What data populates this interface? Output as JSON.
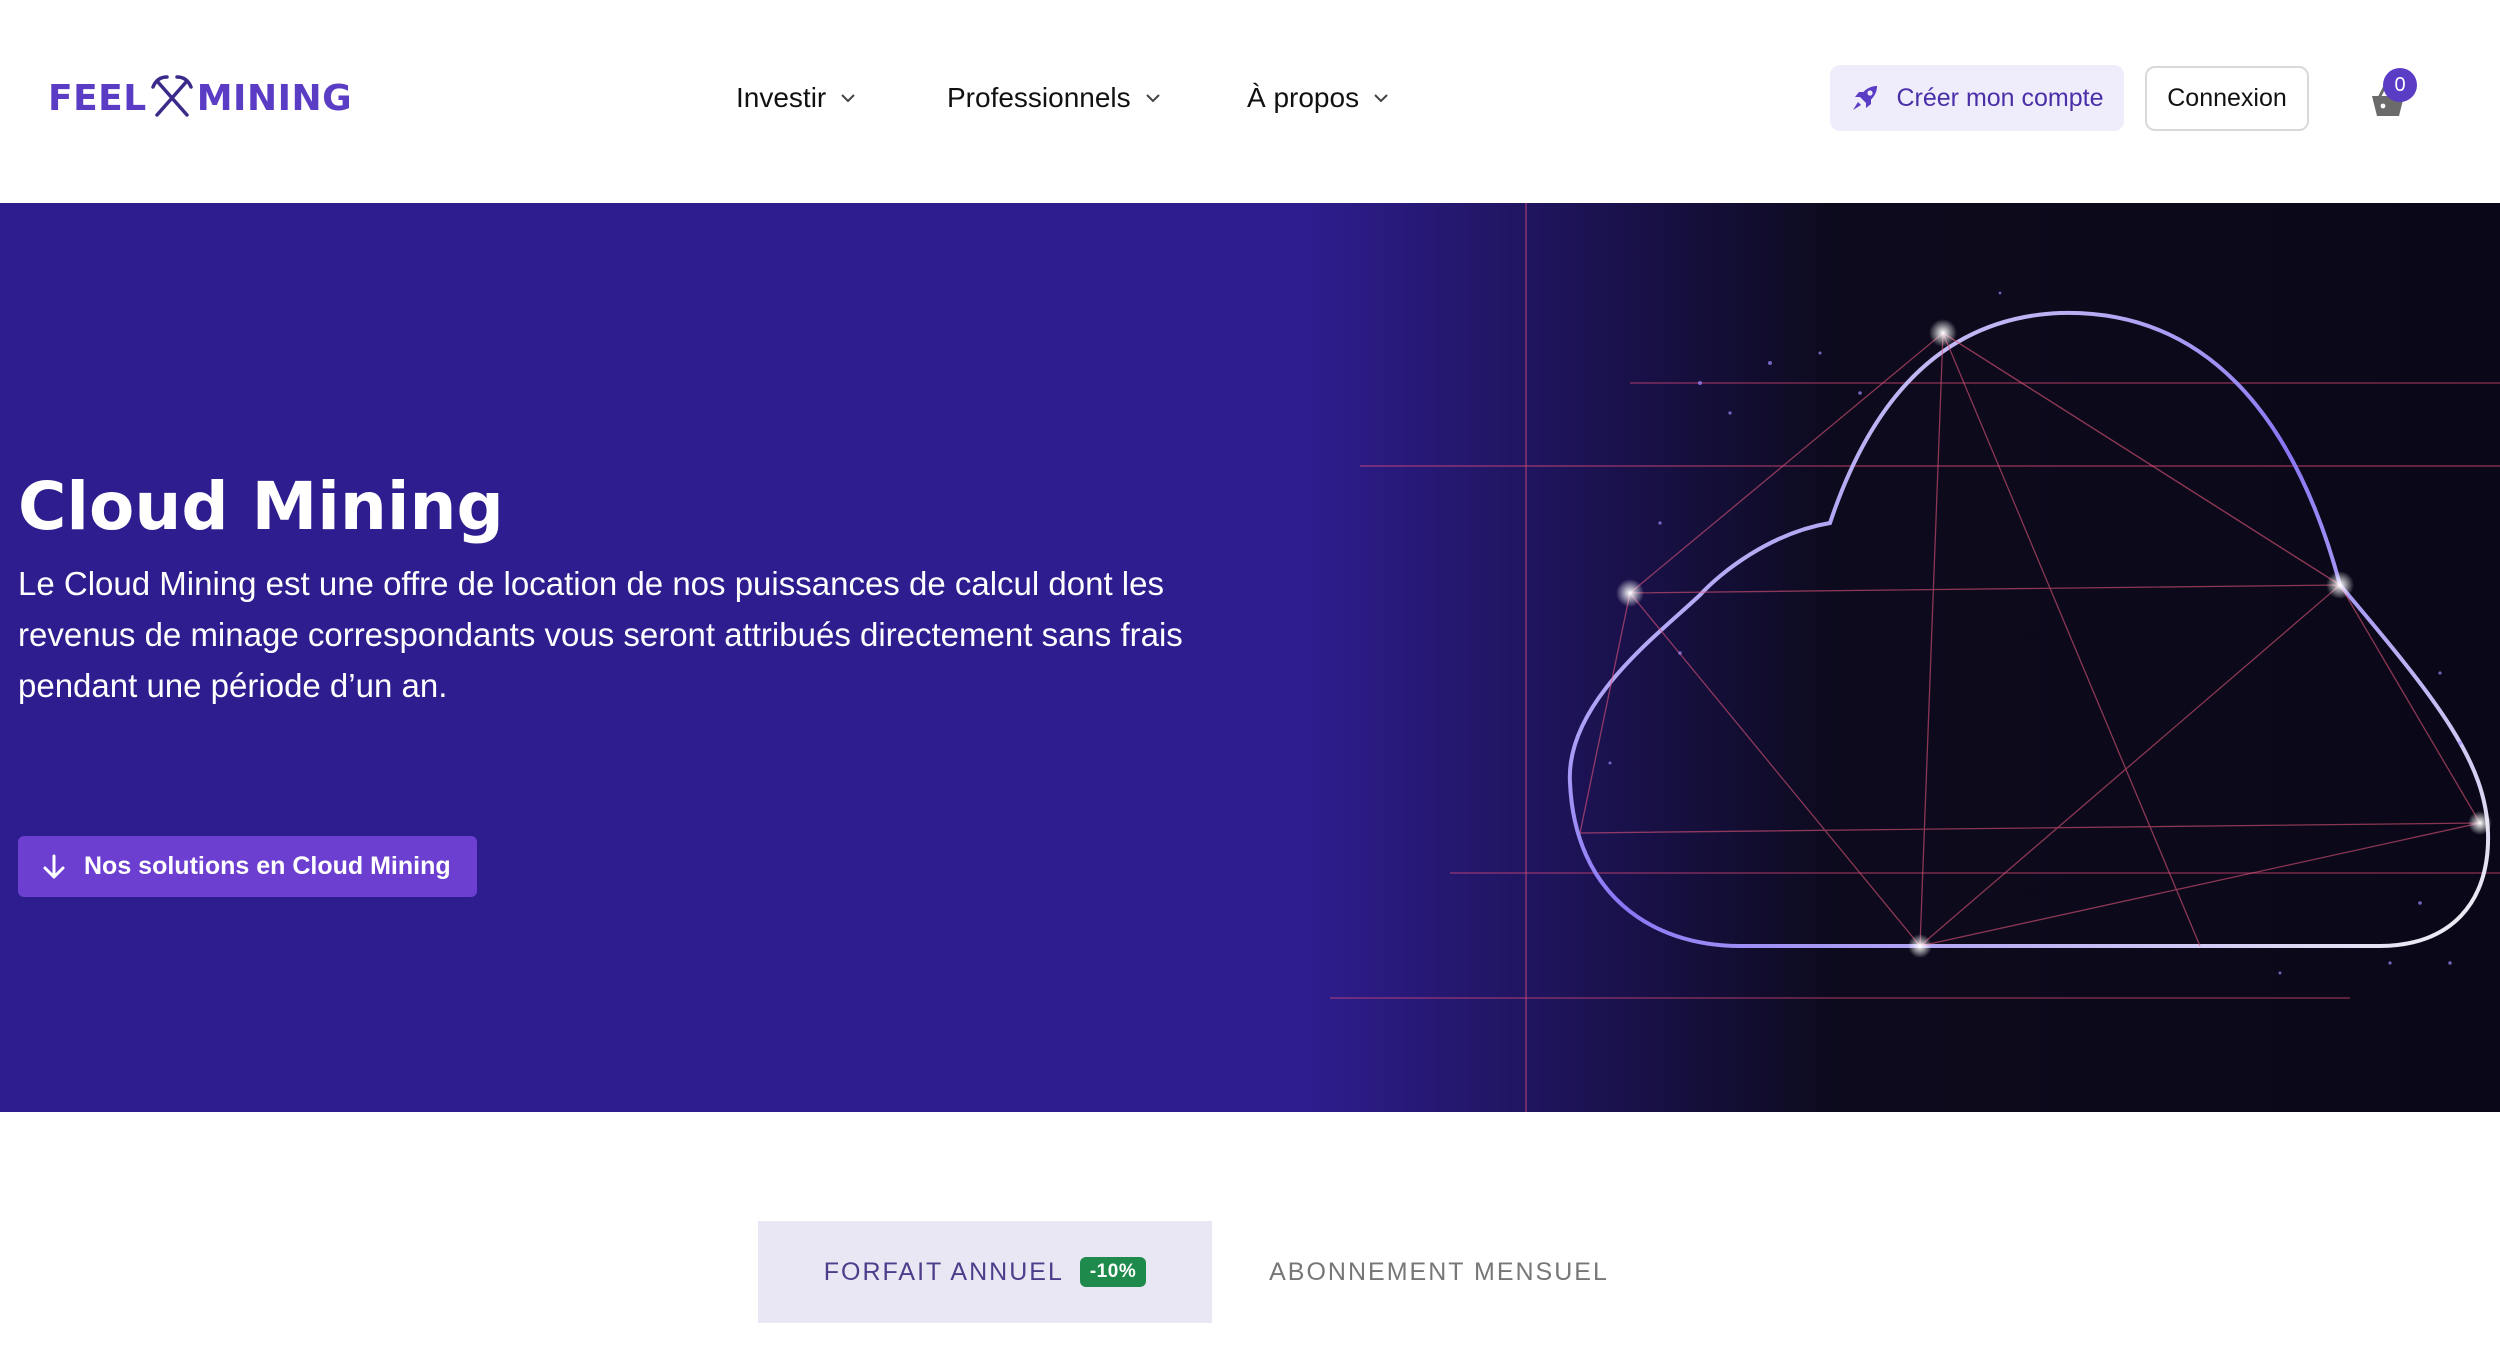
{
  "header": {
    "logo": {
      "left": "FEEL",
      "right": "MINING",
      "icon": "crossed-pickaxes-icon"
    },
    "nav": [
      {
        "label": "Investir",
        "icon": "chevron-down-icon"
      },
      {
        "label": "Professionnels",
        "icon": "chevron-down-icon"
      },
      {
        "label": "À propos",
        "icon": "chevron-down-icon"
      }
    ],
    "create_account": {
      "label": "Créer mon compte",
      "icon": "rocket-icon"
    },
    "login": {
      "label": "Connexion"
    },
    "cart": {
      "icon": "basket-icon",
      "count": "0"
    }
  },
  "hero": {
    "title": "Cloud Mining",
    "description": "Le Cloud Mining est une offre de location de nos puissances de calcul dont les revenus de minage correspondants vous seront attribués directement sans frais pendant une période d’un an.",
    "cta": {
      "label": "Nos solutions en Cloud Mining",
      "icon": "arrow-down-icon"
    },
    "image": "glowing-cloud-illustration"
  },
  "tabs": [
    {
      "label": "FORFAIT ANNUEL",
      "badge": "-10%",
      "active": true
    },
    {
      "label": "ABONNEMENT MENSUEL",
      "active": false
    }
  ],
  "colors": {
    "brand": "#5b3cc4",
    "hero_bg": "#2e1d8f",
    "cta_bg": "#6c3fd1",
    "badge_bg": "#1e8a4c"
  }
}
